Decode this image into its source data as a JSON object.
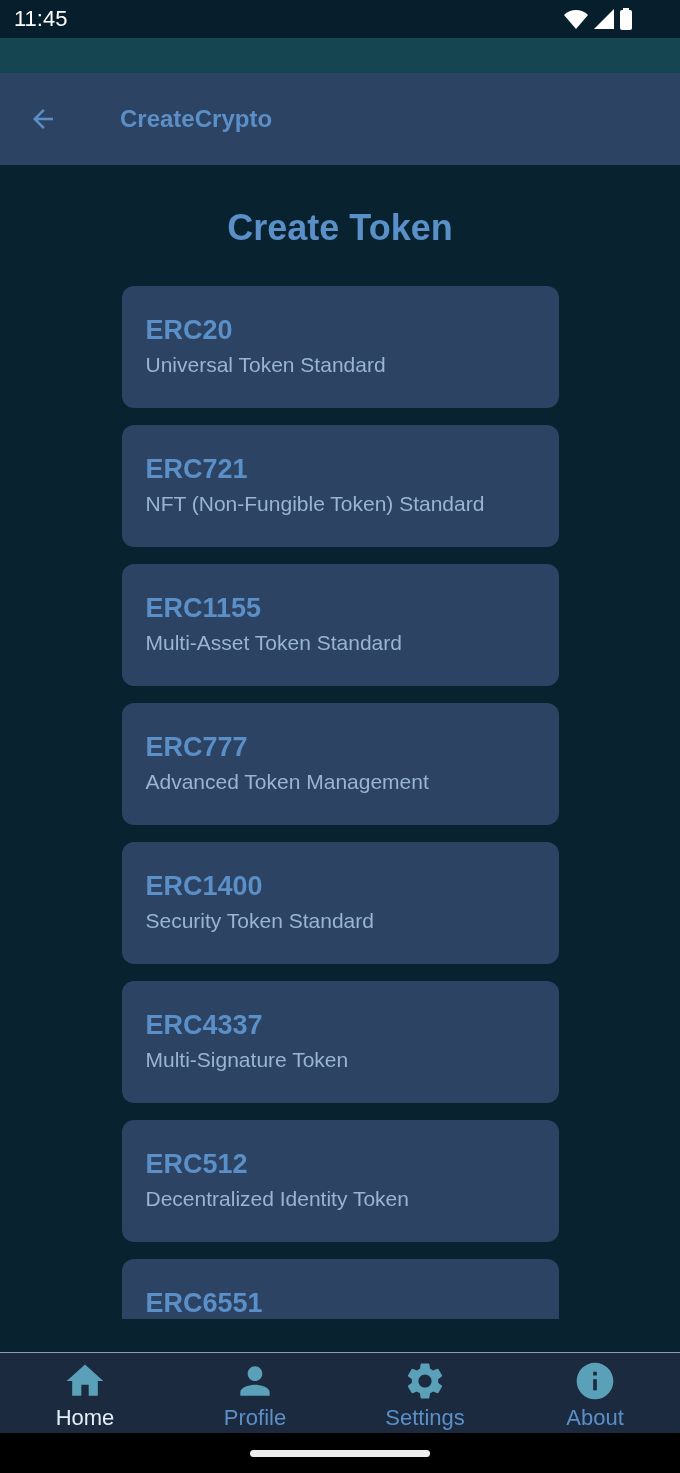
{
  "status_bar": {
    "time": "11:45"
  },
  "app_bar": {
    "title": "CreateCrypto"
  },
  "heading": "Create Token",
  "tokens": [
    {
      "name": "ERC20",
      "description": "Universal Token Standard"
    },
    {
      "name": "ERC721",
      "description": "NFT (Non-Fungible Token) Standard"
    },
    {
      "name": "ERC1155",
      "description": "Multi-Asset Token Standard"
    },
    {
      "name": "ERC777",
      "description": "Advanced Token Management"
    },
    {
      "name": "ERC1400",
      "description": "Security Token Standard"
    },
    {
      "name": "ERC4337",
      "description": "Multi-Signature Token"
    },
    {
      "name": "ERC512",
      "description": "Decentralized Identity Token"
    },
    {
      "name": "ERC6551"
    }
  ],
  "bottom_nav": [
    {
      "kind": "home",
      "label": "Home",
      "selected": true
    },
    {
      "kind": "profile",
      "label": "Profile",
      "selected": false
    },
    {
      "kind": "settings",
      "label": "Settings",
      "selected": false
    },
    {
      "kind": "about",
      "label": "About",
      "selected": false
    }
  ]
}
